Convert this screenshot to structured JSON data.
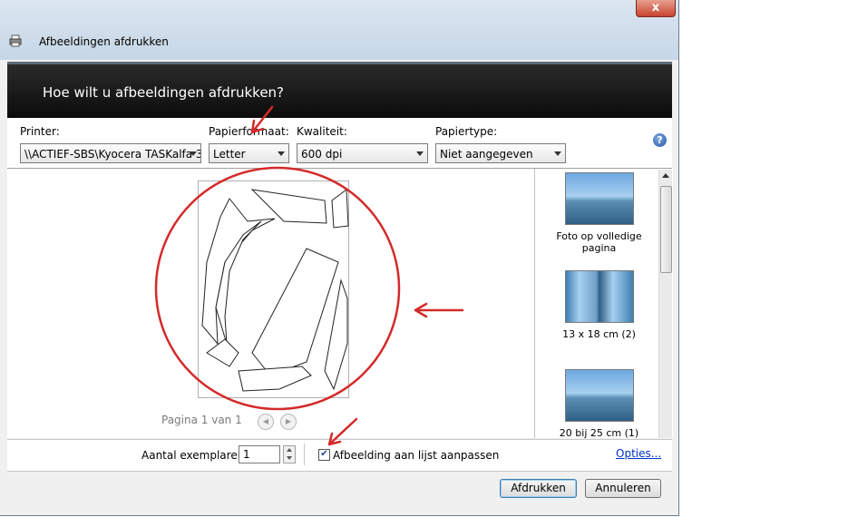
{
  "window": {
    "title": "Afbeeldingen afdrukken",
    "close_glyph": "x"
  },
  "banner": {
    "heading": "Hoe wilt u afbeeldingen afdrukken?"
  },
  "options": {
    "printer": {
      "label": "Printer:",
      "value": "\\\\ACTIEF-SBS\\Kyocera TASKalfa 3"
    },
    "paper_size": {
      "label": "Papierformaat:",
      "value": "Letter"
    },
    "quality": {
      "label": "Kwaliteit:",
      "value": "600 dpi"
    },
    "paper_type": {
      "label": "Papiertype:",
      "value": "Niet aangegeven"
    },
    "help_glyph": "?"
  },
  "preview": {
    "page_indicator": "Pagina 1 van 1",
    "prev_glyph": "◀",
    "next_glyph": "▶"
  },
  "layouts": [
    {
      "label": "Foto op volledige pagina"
    },
    {
      "label": "13 x 18 cm (2)"
    },
    {
      "label": "20 bij 25 cm (1)"
    }
  ],
  "bottom": {
    "copies_label": "Aantal exemplaren:",
    "copies_value": "1",
    "fit_label": "Afbeelding aan lijst aanpassen",
    "fit_checked": true,
    "options_link": "Opties..."
  },
  "buttons": {
    "print": "Afdrukken",
    "cancel": "Annuleren"
  },
  "colors": {
    "annotation": "#d42a2a",
    "banner": "#111111",
    "link": "#0033cc"
  }
}
